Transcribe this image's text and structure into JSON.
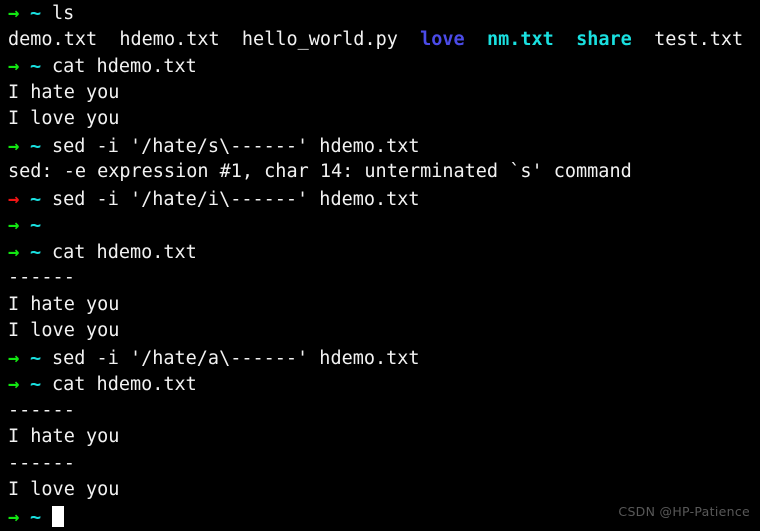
{
  "terminal": {
    "background_color": "#000000",
    "prompt_ok_color": "#12e712",
    "prompt_error_color": "#f01414",
    "tilde_color": "#1ae0e0",
    "text_color": "#f2f2f2",
    "prompt_arrow_ok": "→",
    "prompt_arrow_error": "→",
    "prompt_tilde": "~",
    "lines": {
      "l01_cmd": "ls",
      "l02_ls_f1": "demo.txt",
      "l02_ls_f2": "hdemo.txt",
      "l02_ls_f3": "hello_world.py",
      "l02_ls_f4": "love",
      "l02_ls_f5": "nm.txt",
      "l02_ls_f6": "share",
      "l02_ls_f7": "test.txt",
      "l03_cmd": "cat hdemo.txt",
      "l04_out": "I hate you",
      "l05_out": "I love you",
      "l06_cmd": "sed -i '/hate/s\\------' hdemo.txt",
      "l07_err": "sed: -e expression #1, char 14: unterminated `s' command",
      "l08_cmd": "sed -i '/hate/i\\------' hdemo.txt",
      "l09_cmd": "",
      "l10_cmd": "cat hdemo.txt",
      "l11_out": "------",
      "l12_out": "I hate you",
      "l13_out": "I love you",
      "l14_cmd": "sed -i '/hate/a\\------' hdemo.txt",
      "l15_cmd": "cat hdemo.txt",
      "l16_out": "------",
      "l17_out": "I hate you",
      "l18_out": "------",
      "l19_out": "I love you",
      "l20_cmd": ""
    }
  },
  "ls_colors": {
    "file": "#f2f2f2",
    "directory": "#4b4be8",
    "link": "#1ae0e0"
  },
  "watermark": {
    "text": "CSDN @HP-Patience",
    "color": "#585858"
  }
}
